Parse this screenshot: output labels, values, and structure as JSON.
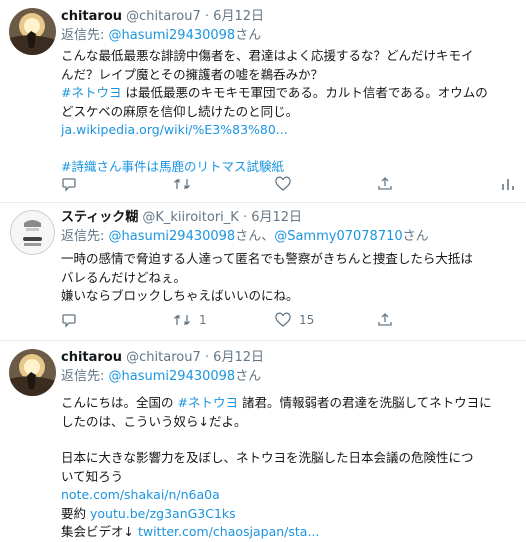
{
  "tweets": [
    {
      "name": "chitarou",
      "handle": "@chitarou7",
      "dot": "·",
      "date": "6月12日",
      "reply_prefix": "返信先:",
      "reply_to": [
        "@hasumi29430098"
      ],
      "reply_suffix": "さん",
      "body_lines": [
        {
          "text": "こんな最低最悪な誹謗中傷者を、君達はよく応援するな？どんだけキモイ"
        },
        {
          "text": "んだ？レイプ魔とその擁護者の嘘を鵜呑みか？"
        },
        {
          "link": "#ネトウヨ",
          "text": " は最低最悪のキモキモ軍団である。カルト信者である。オウムの"
        },
        {
          "text": "どスケベの麻原を信仰し続けたのと同じ。"
        },
        {
          "link": "ja.wikipedia.org/wiki/%E3%83%80..."
        },
        {
          "gap": true
        },
        {
          "link": "#詩織さん事件は馬鹿のリトマス試験紙"
        }
      ],
      "counts": {
        "reply": "",
        "retweet": "",
        "like": ""
      }
    },
    {
      "name": "スティック糊",
      "handle": "@K_kiiroitori_K",
      "dot": "·",
      "date": "6月12日",
      "reply_prefix": "返信先:",
      "reply_to": [
        "@hasumi29430098",
        "@Sammy07078710"
      ],
      "reply_mid": "さん、",
      "reply_suffix": "さん",
      "body_lines": [
        {
          "text": "一時の感情で脅迫する人達って匿名でも警察がきちんと捜査したら大抵は"
        },
        {
          "text": "バレるんだけどねぇ。"
        },
        {
          "text": "嫌いならブロックしちゃえばいいのにね。"
        }
      ],
      "counts": {
        "reply": "",
        "retweet": "1",
        "like": "15"
      }
    },
    {
      "name": "chitarou",
      "handle": "@chitarou7",
      "dot": "·",
      "date": "6月12日",
      "reply_prefix": "返信先:",
      "reply_to": [
        "@hasumi29430098"
      ],
      "reply_suffix": "さん",
      "body_lines": [
        {
          "text": "こんにちは。全国の ",
          "link": "#ネトウヨ",
          "text2": " 諸君。情報弱者の君達を洗脳してネトウヨに"
        },
        {
          "text": "したのは、こういう奴ら↓だよ。"
        },
        {
          "gap": true
        },
        {
          "text": "日本に大きな影響力を及ぼし、ネトウヨを洗脳した日本会議の危険性につ"
        },
        {
          "text": "いて知ろう"
        },
        {
          "link": "note.com/shakai/n/n6a0a"
        },
        {
          "text": "要約 ",
          "link": "youtu.be/zg3anG3C1ks"
        },
        {
          "text": "集会ビデオ↓ ",
          "link": "twitter.com/chaosjapan/sta..."
        }
      ],
      "counts": {
        "reply": "",
        "retweet": "",
        "like": ""
      }
    }
  ],
  "icons": [
    "reply-icon",
    "retweet-icon",
    "like-icon",
    "share-icon",
    "analytics-icon"
  ],
  "colors": {
    "link": "#1b95e0",
    "muted": "#657786",
    "text": "#14171a",
    "border": "#e6ecf0"
  }
}
